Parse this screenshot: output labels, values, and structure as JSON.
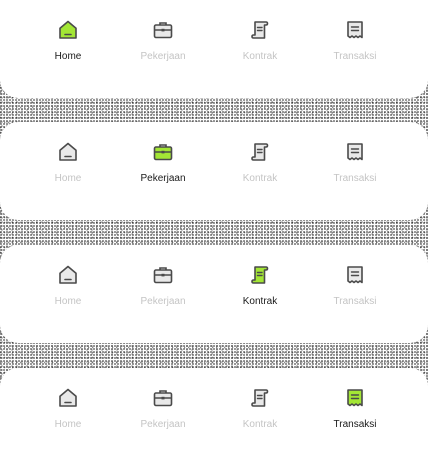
{
  "colors": {
    "accent": "#a3e635",
    "stroke": "#4a4a4a",
    "icon_fill_inactive": "#e9e9e9",
    "label_active": "#1a1a1a",
    "label_inactive": "#c4c4c4"
  },
  "nav_items": {
    "home": "Home",
    "pekerjaan": "Pekerjaan",
    "kontrak": "Kontrak",
    "transaksi": "Transaksi"
  },
  "icons": {
    "home": "home-icon",
    "pekerjaan": "briefcase-icon",
    "kontrak": "scroll-contract-icon",
    "transaksi": "receipt-icon"
  },
  "states": [
    {
      "active": "home"
    },
    {
      "active": "pekerjaan"
    },
    {
      "active": "kontrak"
    },
    {
      "active": "transaksi"
    }
  ]
}
